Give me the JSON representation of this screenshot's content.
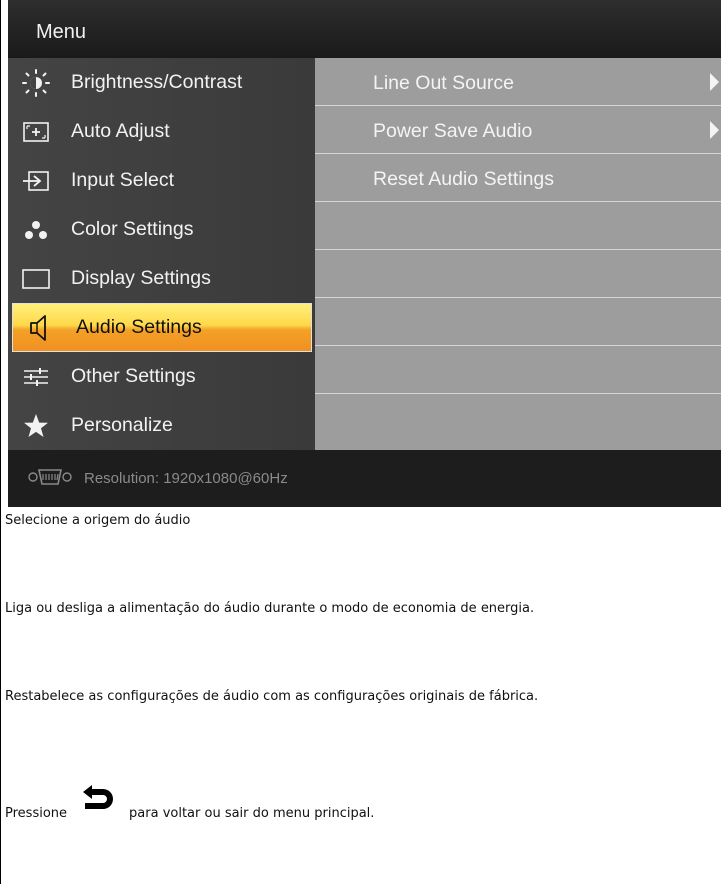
{
  "osd": {
    "title": "Menu",
    "sidebar": [
      {
        "label": "Brightness/Contrast",
        "icon": "sun-icon"
      },
      {
        "label": "Auto Adjust",
        "icon": "auto-adjust-icon"
      },
      {
        "label": "Input Select",
        "icon": "input-arrow-icon"
      },
      {
        "label": "Color Settings",
        "icon": "dots-icon"
      },
      {
        "label": "Display Settings",
        "icon": "display-rect-icon"
      },
      {
        "label": "Audio Settings",
        "icon": "speaker-icon",
        "active": true
      },
      {
        "label": "Other Settings",
        "icon": "sliders-icon"
      },
      {
        "label": "Personalize",
        "icon": "star-icon"
      }
    ],
    "submenu": [
      {
        "label": "Line Out Source",
        "has_arrow": true
      },
      {
        "label": "Power Save Audio",
        "has_arrow": true
      },
      {
        "label": "Reset Audio Settings",
        "has_arrow": false
      }
    ],
    "status": "Resolution: 1920x1080@60Hz"
  },
  "descriptions": {
    "line_out": "Selecione a origem do áudio",
    "power_save": "Liga ou desliga a alimentação do áudio durante o modo de economia de energia.",
    "reset": "Restabelece as configurações de áudio com as configurações originais de fábrica.",
    "return_before": "Pressione",
    "return_after": "para voltar ou sair do menu principal."
  },
  "colors": {
    "osd_bg": "#2a2a2a",
    "sidebar_bg": "#444444",
    "submenu_bg": "#9d9d9d",
    "active_highlight": "#f3a128"
  }
}
